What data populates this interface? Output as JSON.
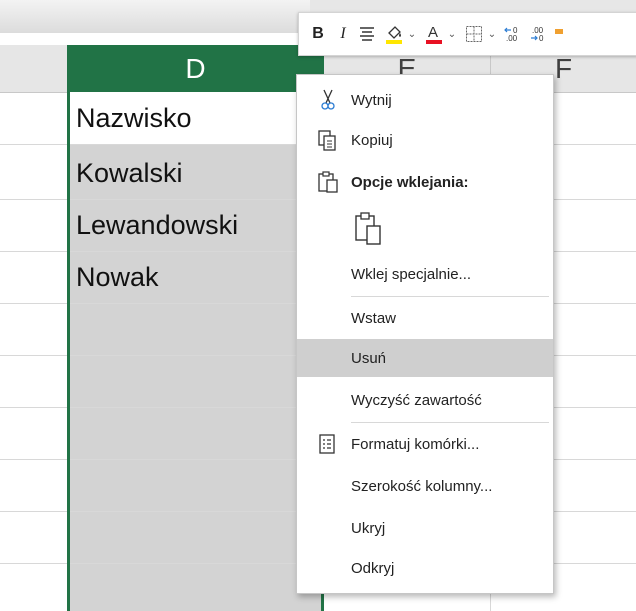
{
  "columns": {
    "d": "D",
    "e": "E",
    "f": "F"
  },
  "cells": [
    "Nazwisko",
    "Kowalski",
    "Lewandowski",
    "Nowak"
  ],
  "mini_toolbar": {
    "bold": "B",
    "italic": "I",
    "increase_decimal": "←0\n.00",
    "decrease_decimal": ".00\n→0"
  },
  "context_menu": {
    "items": [
      {
        "label": "Wytnij",
        "icon": "scissors-icon"
      },
      {
        "label": "Kopiuj",
        "icon": "copy-icon"
      },
      {
        "label": "Opcje wklejania:",
        "icon": "clipboard-icon"
      },
      {
        "label": "",
        "icon": "paste-icon"
      },
      {
        "label": "Wklej specjalnie...",
        "icon": ""
      },
      {
        "label": "Wstaw",
        "icon": ""
      },
      {
        "label": "Usuń",
        "icon": ""
      },
      {
        "label": "Wyczyść zawartość",
        "icon": ""
      },
      {
        "label": "Formatuj komórki...",
        "icon": "format-cells-icon"
      },
      {
        "label": "Szerokość kolumny...",
        "icon": ""
      },
      {
        "label": "Ukryj",
        "icon": ""
      },
      {
        "label": "Odkryj",
        "icon": ""
      }
    ],
    "highlighted": "Usuń"
  },
  "colors": {
    "selection_green": "#217346",
    "selected_fill": "#d3d3d3",
    "menu_highlight": "#cfcfcf",
    "font_color_red": "#e81123",
    "fill_yellow": "#ffe600"
  }
}
